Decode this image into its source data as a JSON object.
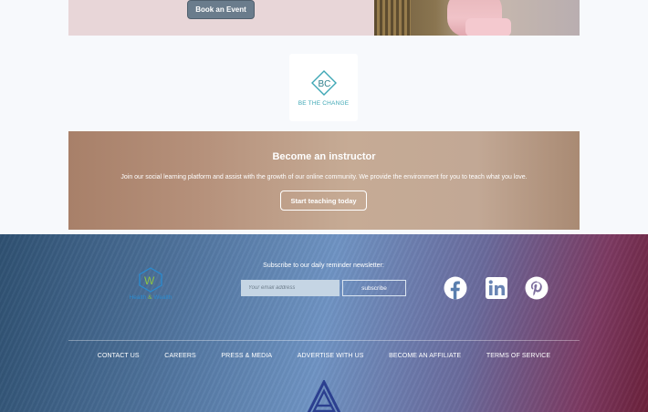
{
  "event": {
    "button_label": "Book an Event"
  },
  "btc_logo": {
    "text": "BE THE CHANGE"
  },
  "instructor": {
    "title": "Become an instructor",
    "description": "Join our social learning platform and assist with the growth of our online community. We provide the environment for you to teach what you love.",
    "button_label": "Start teaching today"
  },
  "footer": {
    "logo_text_a": "Health",
    "logo_text_amp": "&",
    "logo_text_b": "Wealth",
    "newsletter_label": "Subscribe to our daily reminder newsletter:",
    "email_placeholder": "Your email address",
    "subscribe_label": "subscribe",
    "social_icons": [
      "facebook-icon",
      "linkedin-icon",
      "pinterest-icon"
    ],
    "nav": [
      "CONTACT US",
      "CAREERS",
      "PRESS & MEDIA",
      "ADVERTISE WITH US",
      "BECOME AN AFFILIATE",
      "TERMS OF SERVICE"
    ]
  },
  "colors": {
    "event_bg": "#e8d6d8",
    "event_button": "#6a7c8c",
    "btc_accent": "#3ea7b5",
    "footer_left": "#2f5172",
    "footer_right": "#6b203a"
  }
}
